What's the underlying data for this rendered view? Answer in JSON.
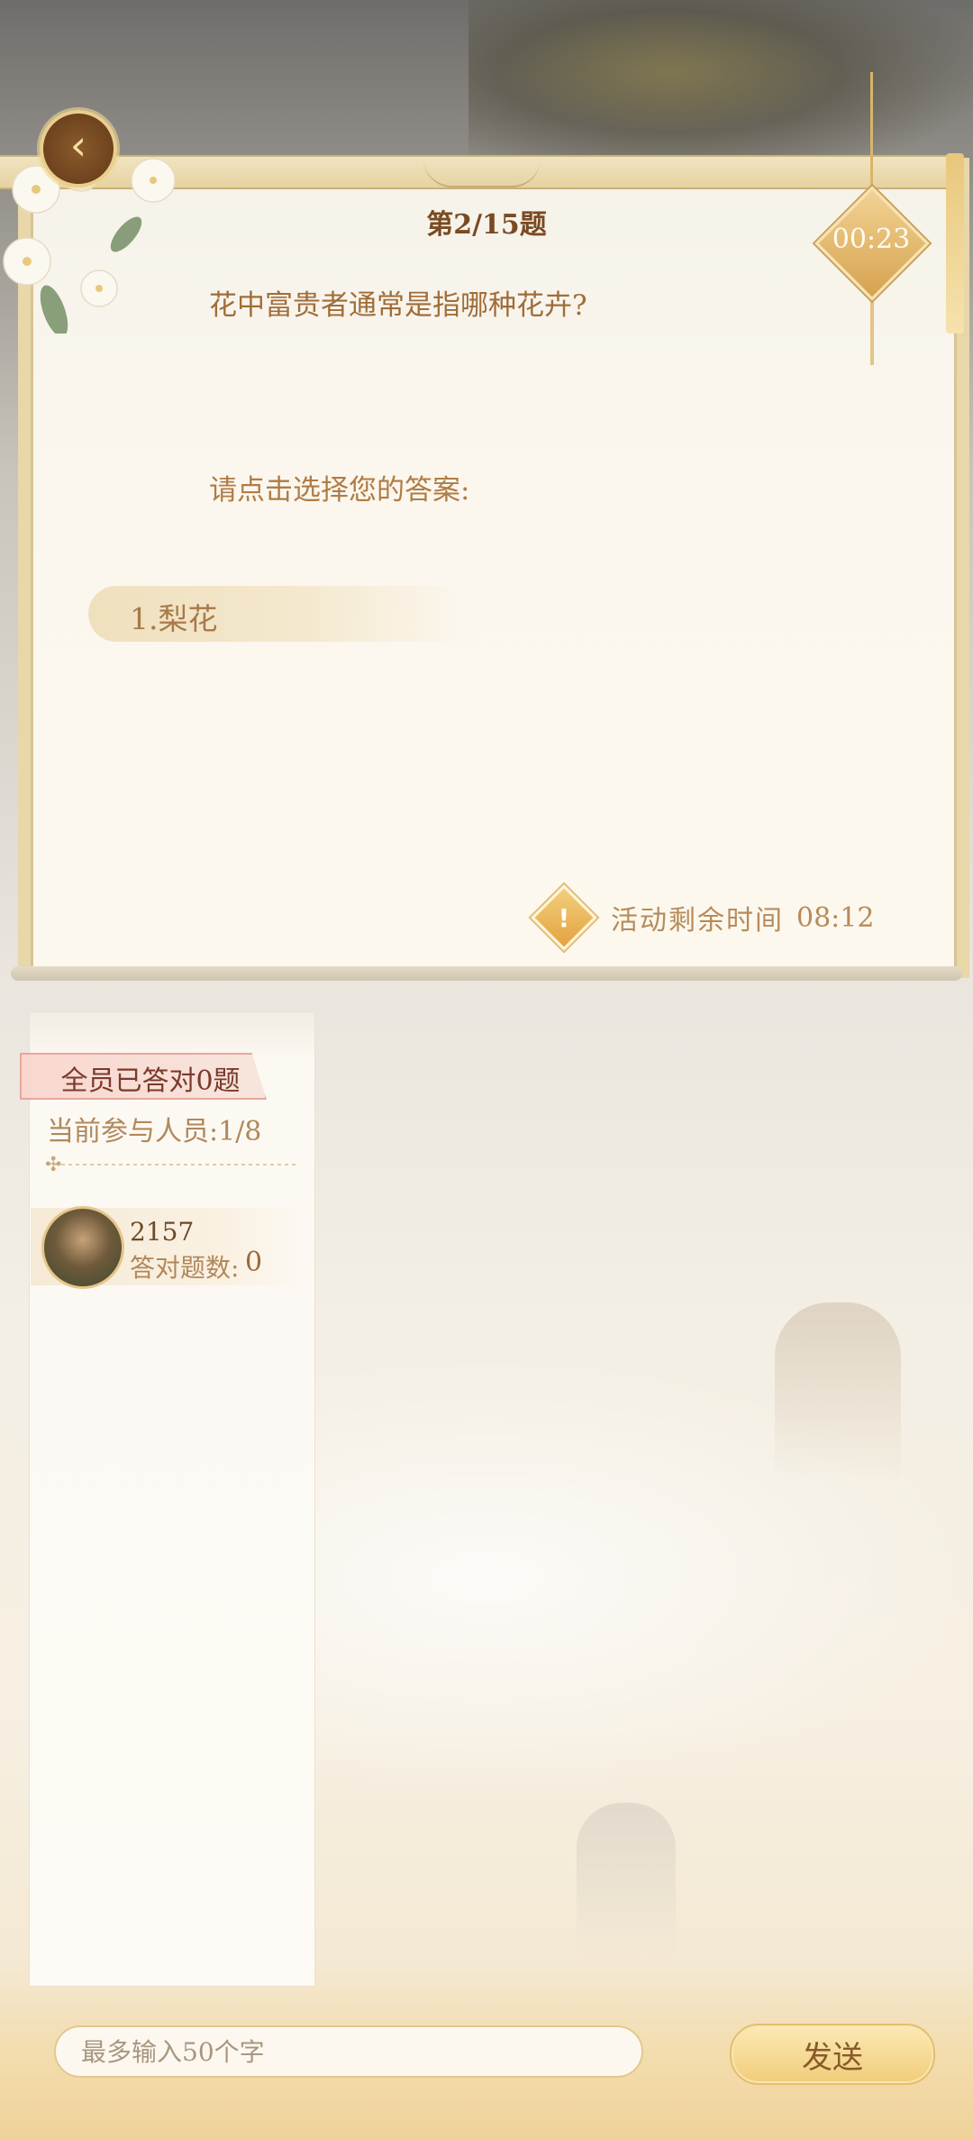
{
  "header": {
    "back_icon": "back-arrow-icon",
    "question_number": "第2/15题",
    "timer": "00:23"
  },
  "question": {
    "text": "花中富贵者通常是指哪种花卉?",
    "prompt": "请点击选择您的答案:",
    "options": [
      {
        "label": "1.梨花"
      }
    ]
  },
  "activity": {
    "icon": "warning-icon",
    "label": "活动剩余时间",
    "remaining": "08:12"
  },
  "participants": {
    "banner": "全员已答对0题",
    "count_text": "当前参与人员:1/8",
    "players": [
      {
        "name": "2157",
        "score_label": "答对题数:",
        "score": "0"
      }
    ]
  },
  "chat": {
    "placeholder": "最多输入50个字",
    "send_label": "发送"
  },
  "colors": {
    "accent_gold": "#e3a23f",
    "text_brown": "#a06d38",
    "panel_bg": "#fbf7ee"
  }
}
